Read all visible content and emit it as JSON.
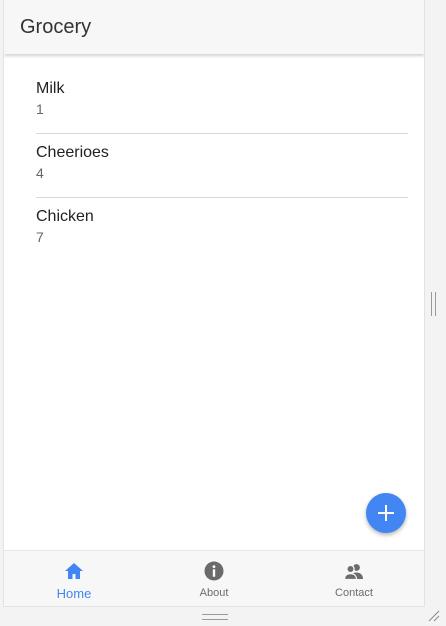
{
  "header": {
    "title": "Grocery"
  },
  "items": [
    {
      "name": "Milk",
      "quantity": "1"
    },
    {
      "name": "Cheerioes",
      "quantity": "4"
    },
    {
      "name": "Chicken",
      "quantity": "7"
    }
  ],
  "fab": {
    "icon": "plus-icon",
    "color": "#4286f4"
  },
  "bottom_nav": {
    "items": [
      {
        "label": "Home",
        "icon": "home-icon",
        "active": true
      },
      {
        "label": "About",
        "icon": "info-icon",
        "active": false
      },
      {
        "label": "Contact",
        "icon": "people-icon",
        "active": false
      }
    ],
    "active_color": "#4286f4",
    "inactive_color": "#6b6b6b"
  }
}
